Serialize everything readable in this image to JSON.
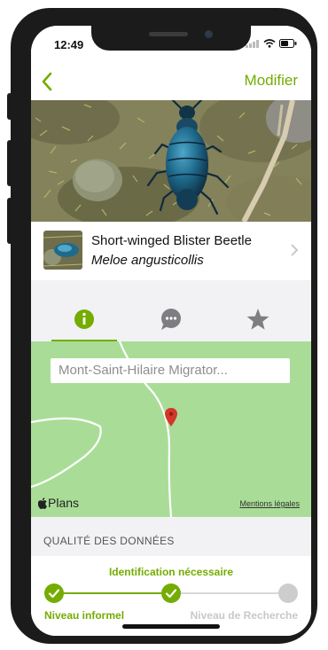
{
  "status": {
    "time": "12:49"
  },
  "nav": {
    "back_label": "<",
    "edit_label": "Modifier"
  },
  "species": {
    "common_name": "Short-winged Blister Beetle",
    "scientific_name": "Meloe angusticollis"
  },
  "tabs": [
    {
      "name": "info",
      "icon": "info-icon",
      "active": true
    },
    {
      "name": "comments",
      "icon": "speech-bubble-icon",
      "active": false
    },
    {
      "name": "favorites",
      "icon": "star-icon",
      "active": false
    }
  ],
  "map": {
    "place": "Mont-Saint-Hilaire Migrator...",
    "provider": "Plans",
    "legal": "Mentions légales"
  },
  "quality": {
    "section_title": "QUALITÉ DES DONNÉES",
    "needed_label": "Identification nécessaire",
    "casual_label": "Niveau informel",
    "research_label": "Niveau de Recherche"
  },
  "colors": {
    "accent": "#74ac00",
    "map_bg": "#a9dd97",
    "pin": "#d3362a"
  }
}
